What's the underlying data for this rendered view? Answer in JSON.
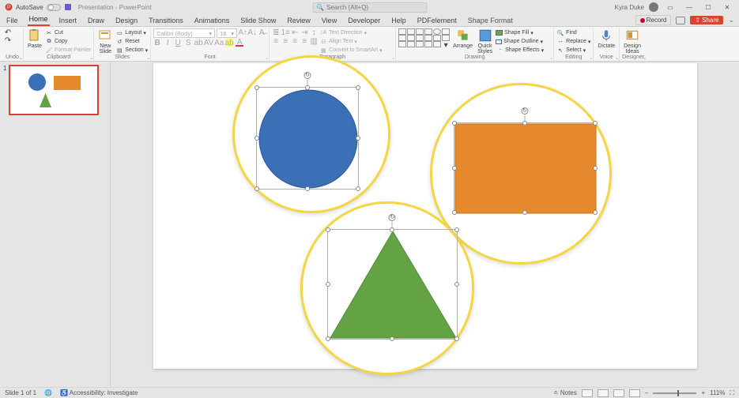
{
  "titlebar": {
    "autosave_label": "AutoSave",
    "autosave_state": "Off",
    "doc_title": "Presentation - PowerPoint",
    "search_placeholder": "Search (Alt+Q)",
    "user_name": "Kyra Duke",
    "record_label": "Record",
    "share_label": "Share"
  },
  "tabs": {
    "file": "File",
    "home": "Home",
    "insert": "Insert",
    "draw": "Draw",
    "design": "Design",
    "transitions": "Transitions",
    "animations": "Animations",
    "slideshow": "Slide Show",
    "review": "Review",
    "view": "View",
    "developer": "Developer",
    "help": "Help",
    "pdfelement": "PDFelement",
    "shape_format": "Shape Format"
  },
  "ribbon": {
    "undo": {
      "label": "Undo"
    },
    "clipboard": {
      "paste": "Paste",
      "cut": "Cut",
      "copy": "Copy",
      "format_painter": "Format Painter",
      "label": "Clipboard"
    },
    "slides": {
      "new_slide": "New\nSlide",
      "layout": "Layout",
      "reset": "Reset",
      "section": "Section",
      "label": "Slides"
    },
    "font": {
      "family": "Calibri (Body)",
      "size": "18",
      "label": "Font"
    },
    "paragraph": {
      "text_direction": "Text Direction",
      "align_text": "Align Text",
      "convert_smartart": "Convert to SmartArt",
      "label": "Paragraph"
    },
    "drawing": {
      "arrange": "Arrange",
      "quick_styles": "Quick\nStyles",
      "shape_fill": "Shape Fill",
      "shape_outline": "Shape Outline",
      "shape_effects": "Shape Effects",
      "label": "Drawing"
    },
    "editing": {
      "find": "Find",
      "replace": "Replace",
      "select": "Select",
      "label": "Editing"
    },
    "voice": {
      "dictate": "Dictate",
      "label": "Voice"
    },
    "designer": {
      "design_ideas": "Design\nIdeas",
      "label": "Designer"
    }
  },
  "thumbnail": {
    "number": "1"
  },
  "statusbar": {
    "slide_info": "Slide 1 of 1",
    "accessibility": "Accessibility: Investigate",
    "notes": "Notes",
    "zoom": "111%"
  },
  "colors": {
    "accent": "#d64531",
    "circle": "#3b6fb6",
    "rect": "#e78a2d",
    "triangle": "#63a344",
    "spotlight_ring": "#f4d542"
  }
}
